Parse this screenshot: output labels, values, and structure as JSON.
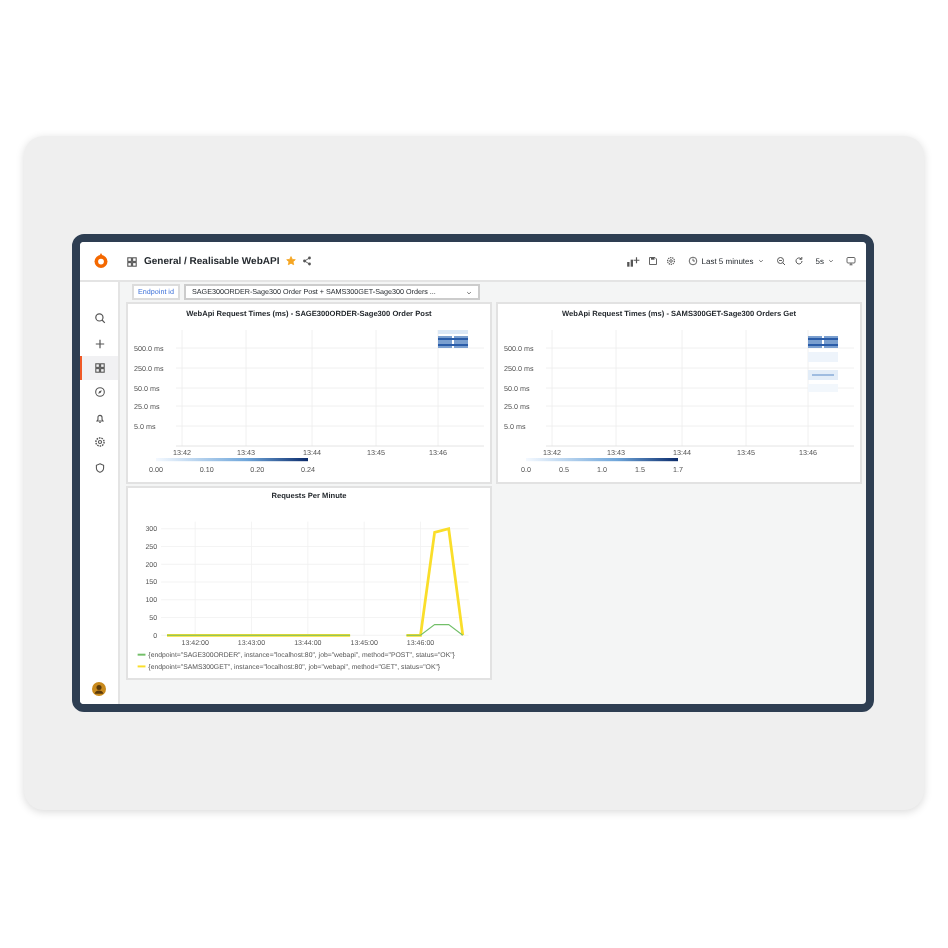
{
  "topbar": {
    "breadcrumb": "General / Realisable WebAPI",
    "starred": true,
    "time_range": "Last 5 minutes",
    "refresh_interval": "5s"
  },
  "sidebar": {
    "items": [
      {
        "kind": "search",
        "selected": false
      },
      {
        "kind": "plus",
        "selected": false
      },
      {
        "kind": "grid",
        "selected": true
      },
      {
        "kind": "compass",
        "selected": false
      },
      {
        "kind": "bell",
        "selected": false
      },
      {
        "kind": "gear",
        "selected": false
      },
      {
        "kind": "shield",
        "selected": false
      }
    ]
  },
  "variables": [
    {
      "label": "Endpoint id",
      "value": "SAGE300ORDER-Sage300 Order Post + SAMS300GET-Sage300 Orders ..."
    }
  ],
  "panels": [
    {
      "kind": "heatmap",
      "title": "WebApi Request Times (ms) - SAGE300ORDER-Sage300 Order Post",
      "y_labels": [
        "500.0 ms",
        "250.0 ms",
        "50.0 ms",
        "25.0 ms",
        "5.0 ms"
      ],
      "x_labels": [
        "13:42",
        "13:43",
        "13:44",
        "13:45",
        "13:46"
      ],
      "scale_labels": [
        "0.00",
        "0.10",
        "0.20",
        "0.24"
      ]
    },
    {
      "kind": "heatmap",
      "title": "WebApi Request Times (ms) - SAMS300GET-Sage300 Orders Get",
      "y_labels": [
        "500.0 ms",
        "250.0 ms",
        "50.0 ms",
        "25.0 ms",
        "5.0 ms"
      ],
      "x_labels": [
        "13:42",
        "13:43",
        "13:44",
        "13:45",
        "13:46"
      ],
      "scale_labels": [
        "0.0",
        "0.5",
        "1.0",
        "1.5",
        "1.7"
      ]
    },
    {
      "kind": "timeseries",
      "title": "Requests Per Minute",
      "chart_data": {
        "type": "line",
        "grid": true,
        "legend": true,
        "categories": [
          null,
          null,
          "13:42:00",
          null,
          null,
          null,
          "13:43:00",
          null,
          null,
          null,
          "13:44:00",
          null,
          null,
          null,
          "13:45:00",
          null,
          null,
          null,
          "13:46:00",
          null,
          null,
          null
        ],
        "ylim": [
          0,
          320
        ],
        "yticks": [
          0,
          50,
          100,
          150,
          200,
          250,
          300
        ],
        "series": [
          {
            "name": "{endpoint=\"SAGE300ORDER\", instance=\"localhost:80\", job=\"webapi\", method=\"POST\", status=\"OK\"}",
            "color": "#73bf69",
            "values": [
              0,
              0,
              0,
              0,
              0,
              0,
              0,
              0,
              0,
              0,
              0,
              0,
              0,
              0,
              null,
              null,
              null,
              0,
              0,
              30,
              30,
              0
            ]
          },
          {
            "name": "{endpoint=\"SAMS300GET\", instance=\"localhost:80\", job=\"webapi\", method=\"GET\", status=\"OK\"}",
            "color": "#fade2a",
            "values": [
              0,
              0,
              0,
              0,
              0,
              0,
              0,
              0,
              0,
              0,
              0,
              0,
              0,
              0,
              null,
              null,
              null,
              0,
              0,
              290,
              300,
              0
            ]
          }
        ]
      }
    }
  ]
}
